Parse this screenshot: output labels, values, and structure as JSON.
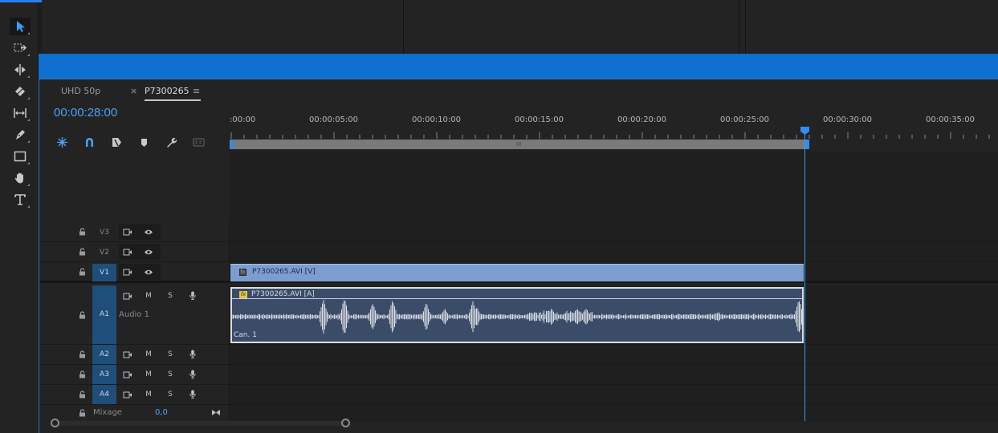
{
  "colors": {
    "accent": "#2f8ef0",
    "title_band": "#0f6fd1",
    "video_clip": "#7c9dd0",
    "audio_clip": "#3b4c69",
    "track_on": "#1f4e7a"
  },
  "tools": [
    {
      "name": "selection-tool",
      "icon": "arrow-icon"
    },
    {
      "name": "track-select-tool",
      "icon": "dashed-arrow-icon"
    },
    {
      "name": "ripple-edit-tool",
      "icon": "ripple-icon"
    },
    {
      "name": "razor-tool",
      "icon": "razor-icon"
    },
    {
      "name": "slip-tool",
      "icon": "slip-icon"
    },
    {
      "name": "pen-tool",
      "icon": "pen-icon"
    },
    {
      "name": "rectangle-tool",
      "icon": "rectangle-icon"
    },
    {
      "name": "hand-tool",
      "icon": "hand-icon"
    },
    {
      "name": "type-tool",
      "icon": "type-icon"
    }
  ],
  "tabs": [
    {
      "label": "UHD 50p"
    },
    {
      "label": "P7300265",
      "close": "×",
      "menu": "≡"
    }
  ],
  "timecode": "00:00:28:00",
  "ruler": {
    "labels": [
      ":00:00",
      "00:00:05:00",
      "00:00:10:00",
      "00:00:15:00",
      "00:00:20:00",
      "00:00:25:00",
      "00:00:30:00",
      "00:00:35:00"
    ]
  },
  "tracks": {
    "video": [
      {
        "name": "V3",
        "targeted": false
      },
      {
        "name": "V2",
        "targeted": false
      },
      {
        "name": "V1",
        "targeted": true
      }
    ],
    "audio": [
      {
        "name": "A1",
        "label": "Audio 1",
        "mute": "M",
        "solo": "S"
      },
      {
        "name": "A2",
        "mute": "M",
        "solo": "S"
      },
      {
        "name": "A3",
        "mute": "M",
        "solo": "S"
      },
      {
        "name": "A4",
        "mute": "M",
        "solo": "S"
      }
    ],
    "mix": {
      "label": "Mixage",
      "value": "0,0"
    }
  },
  "clips": {
    "video": {
      "label": "P7300265.AVI [V]",
      "fx": "fx"
    },
    "audio": {
      "label": "P7300265.AVI [A]",
      "fx": "fx",
      "channel": "Can. 1"
    }
  },
  "work_area_grip": "III"
}
